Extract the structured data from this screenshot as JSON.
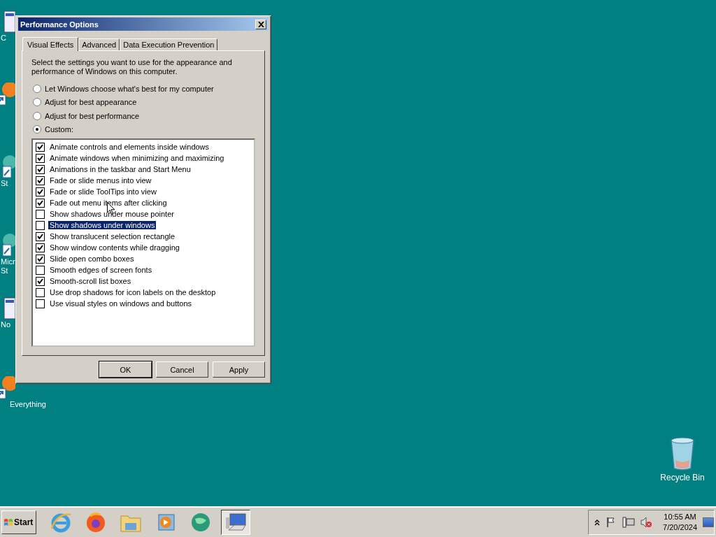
{
  "desktop_icons": [
    {
      "kind": "doc",
      "label": "C"
    },
    {
      "kind": "orange"
    },
    {
      "kind": "app",
      "label": "St"
    },
    {
      "kind": "app",
      "label": "Micr St"
    },
    {
      "kind": "doc",
      "label": "No"
    },
    {
      "kind": "orange",
      "label": "Everything"
    },
    {
      "kind": "recycle",
      "label": "Recycle Bin"
    }
  ],
  "window": {
    "title": "Performance Options"
  },
  "tabs": [
    {
      "label": "Visual Effects",
      "selected": true
    },
    {
      "label": "Advanced",
      "selected": false
    },
    {
      "label": "Data Execution Prevention",
      "selected": false
    }
  ],
  "intro": "Select the settings you want to use for the appearance and performance of Windows on this computer.",
  "options": [
    {
      "label": "Let Windows choose what's best for my computer",
      "selected": false
    },
    {
      "label": "Adjust for best appearance",
      "selected": false
    },
    {
      "label": "Adjust for best performance",
      "selected": false
    },
    {
      "label": "Custom:",
      "selected": true
    }
  ],
  "effects": [
    {
      "label": "Animate controls and elements inside windows",
      "checked": true,
      "selected": false
    },
    {
      "label": "Animate windows when minimizing and maximizing",
      "checked": true,
      "selected": false
    },
    {
      "label": "Animations in the taskbar and Start Menu",
      "checked": true,
      "selected": false
    },
    {
      "label": "Fade or slide menus into view",
      "checked": true,
      "selected": false
    },
    {
      "label": "Fade or slide ToolTips into view",
      "checked": true,
      "selected": false
    },
    {
      "label": "Fade out menu items after clicking",
      "checked": true,
      "selected": false
    },
    {
      "label": "Show shadows under mouse pointer",
      "checked": false,
      "selected": false
    },
    {
      "label": "Show shadows under windows",
      "checked": false,
      "selected": true
    },
    {
      "label": "Show translucent selection rectangle",
      "checked": true,
      "selected": false
    },
    {
      "label": "Show window contents while dragging",
      "checked": true,
      "selected": false
    },
    {
      "label": "Slide open combo boxes",
      "checked": true,
      "selected": false
    },
    {
      "label": "Smooth edges of screen fonts",
      "checked": false,
      "selected": false
    },
    {
      "label": "Smooth-scroll list boxes",
      "checked": true,
      "selected": false
    },
    {
      "label": "Use drop shadows for icon labels on the desktop",
      "checked": false,
      "selected": false
    },
    {
      "label": "Use visual styles on windows and buttons",
      "checked": false,
      "selected": false
    }
  ],
  "buttons": [
    {
      "label": "OK",
      "default": true
    },
    {
      "label": "Cancel",
      "default": false
    },
    {
      "label": "Apply",
      "default": false
    }
  ],
  "taskbar": {
    "start": "Start",
    "apps": [
      {
        "kind": "ie",
        "selected": false
      },
      {
        "kind": "firefox",
        "selected": false
      },
      {
        "kind": "folder",
        "selected": false
      },
      {
        "kind": "media",
        "selected": false
      },
      {
        "kind": "globe",
        "selected": false
      },
      {
        "kind": "monitor",
        "selected": true
      }
    ],
    "clock": {
      "time": "10:55 AM",
      "date": "7/20/2024"
    }
  }
}
